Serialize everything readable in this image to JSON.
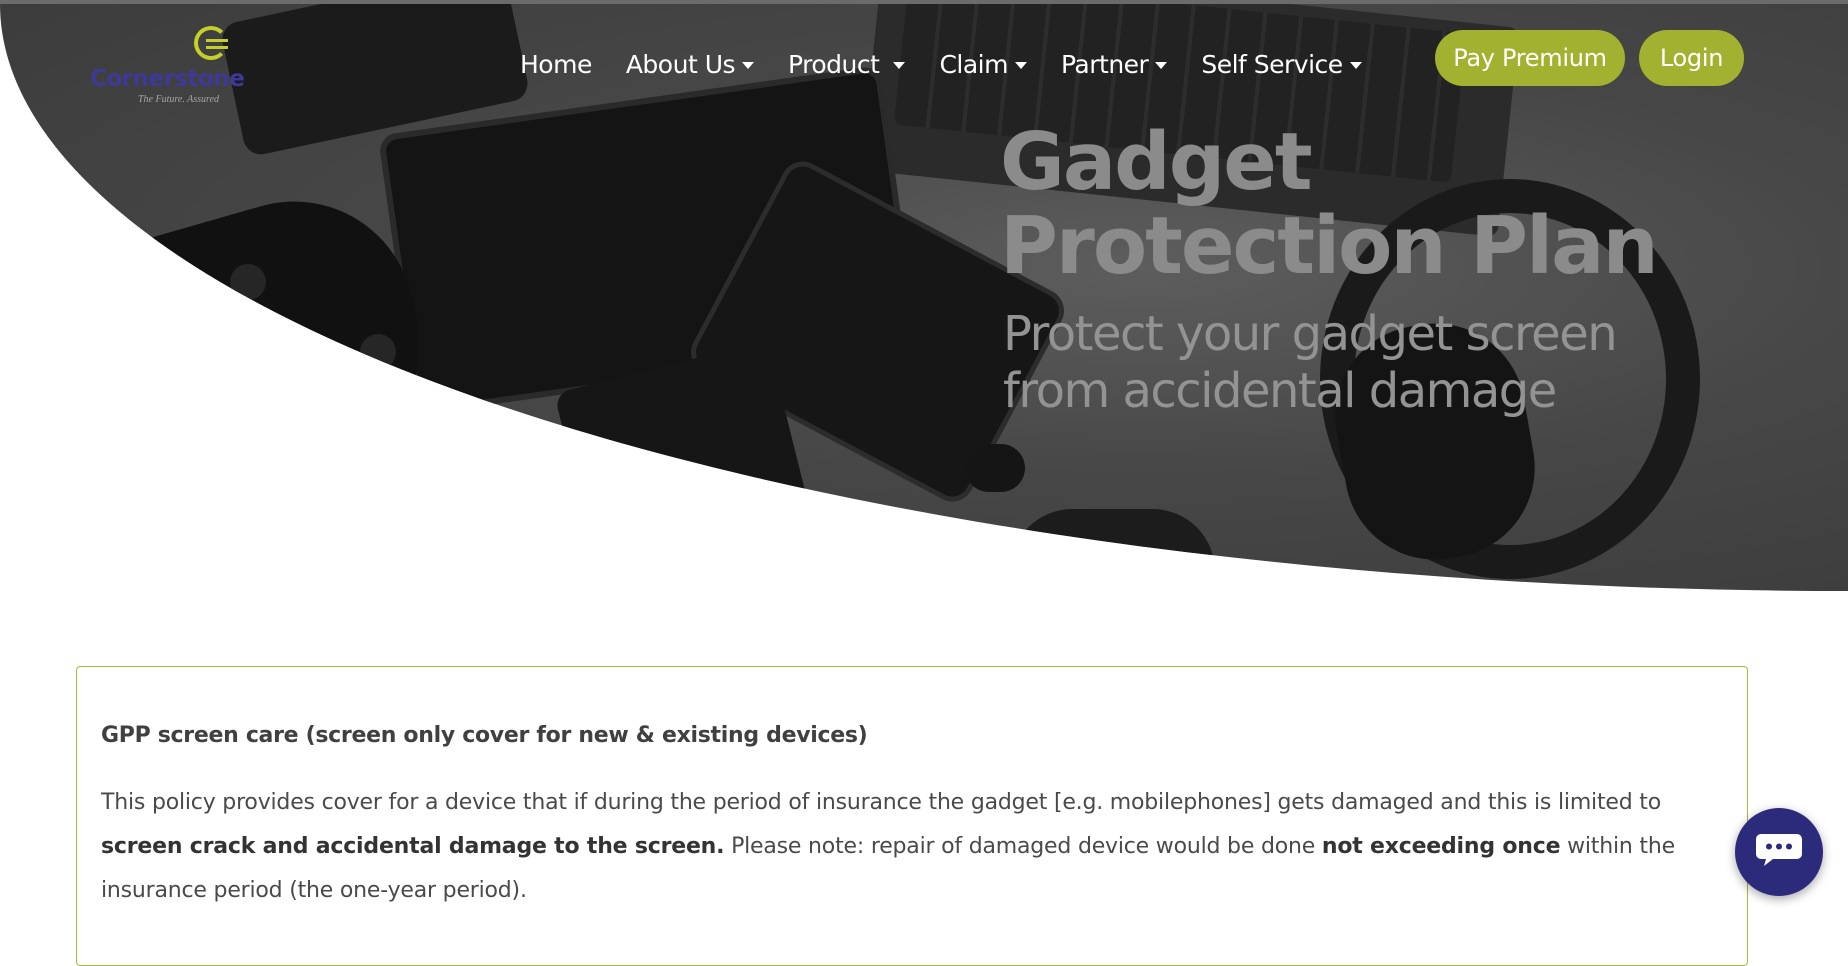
{
  "brand": {
    "name": "Cornerstone",
    "tagline": "The Future. Assured",
    "logo_icon": "cornerstone-c-mark",
    "accent_color": "#a2b12f",
    "brand_color": "#3d3a97"
  },
  "nav": {
    "items": [
      {
        "label": "Home",
        "dropdown": false
      },
      {
        "label": "About Us",
        "dropdown": true
      },
      {
        "label": "Product",
        "dropdown": true
      },
      {
        "label": "Claim",
        "dropdown": true
      },
      {
        "label": "Partner",
        "dropdown": true
      },
      {
        "label": "Self Service",
        "dropdown": true
      }
    ],
    "pay_premium_label": "Pay Premium",
    "login_label": "Login"
  },
  "hero": {
    "title_line1": "Gadget",
    "title_line2": "Protection Plan",
    "subtitle_line1": "Protect your gadget screen",
    "subtitle_line2": "from accidental damage"
  },
  "policy": {
    "heading": "GPP screen care (screen only cover for new & existing devices)",
    "body_part1": "This policy provides cover for a device that if during the period of insurance the gadget [e.g. mobilephones] gets damaged and this is limited to ",
    "body_bold1": "screen crack and accidental damage to the screen.",
    "body_part2": " Please note: repair of damaged device would be done ",
    "body_bold2": "not exceeding once",
    "body_part3": " within the insurance period (the one-year period)."
  },
  "chat": {
    "icon": "chat-bubble-icon",
    "color": "#2c2a7a"
  }
}
